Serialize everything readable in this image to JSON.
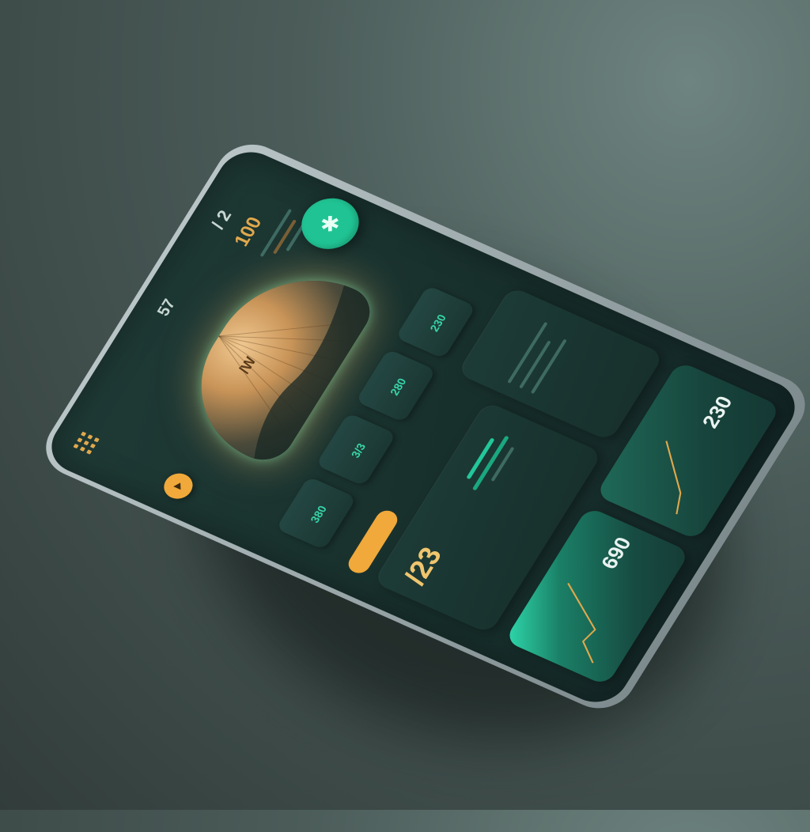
{
  "header": {
    "top_value": "/ 2",
    "top_amount": "100",
    "top_label": "",
    "title": "",
    "title_value": "57"
  },
  "hero": {
    "dome_label": "/W"
  },
  "buttons": {
    "amber_round_icon": "play-icon",
    "mint_round_icon": "asterisk-icon",
    "amber_pill_label": ""
  },
  "stats": [
    {
      "label": "",
      "value": "380"
    },
    {
      "label": "",
      "value": "3/3"
    },
    {
      "label": "",
      "value": "280"
    },
    {
      "label": "",
      "value": "230"
    }
  ],
  "main_card": {
    "value": "/23",
    "body": ""
  },
  "side_card": {
    "title": "",
    "lines": []
  },
  "chart_cards": [
    {
      "value": "690",
      "line": [
        0.1,
        0.35,
        0.3,
        0.6,
        0.9
      ]
    },
    {
      "value": "230",
      "line": [
        0.2,
        0.3,
        0.55,
        0.8
      ]
    }
  ],
  "colors": {
    "accent_amber": "#f0a93a",
    "accent_mint": "#22c79a",
    "panel": "#1c3834"
  }
}
